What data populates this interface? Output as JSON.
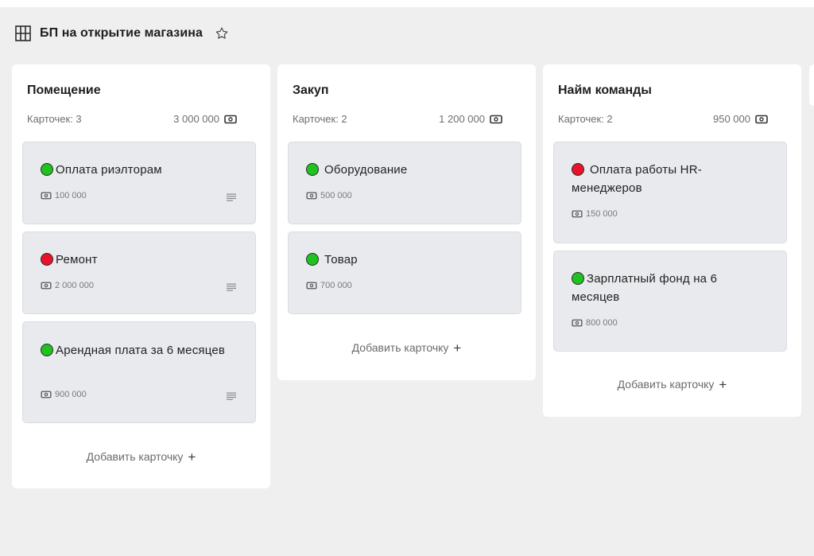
{
  "board": {
    "title": "БП на открытие магазина",
    "icons": {
      "board": "board-grid-icon",
      "favorite": "star-outline-icon"
    }
  },
  "colors": {
    "background": "#efefef",
    "column": "#ffffff",
    "card": "#e9eaed",
    "status_green": "#1fc21f",
    "status_red": "#e8132b"
  },
  "columns": [
    {
      "title": "Помещение",
      "count_label": "Карточек: 3",
      "sum": "3 000 000",
      "add_label": "Добавить карточку",
      "cards": [
        {
          "title": "Оплата риэлторам",
          "status": "green",
          "amount": "100 000",
          "has_description": true
        },
        {
          "title": "Ремонт",
          "status": "red",
          "amount": "2 000 000",
          "has_description": true
        },
        {
          "title": "Арендная плата за 6 месяцев",
          "status": "green",
          "amount": "900 000",
          "has_description": true
        }
      ]
    },
    {
      "title": "Закуп",
      "count_label": "Карточек: 2",
      "sum": "1 200 000",
      "add_label": "Добавить карточку",
      "cards": [
        {
          "title": "Оборудование",
          "status": "green",
          "amount": "500 000",
          "has_description": false
        },
        {
          "title": "Товар",
          "status": "green",
          "amount": "700 000",
          "has_description": false
        }
      ]
    },
    {
      "title": "Найм команды",
      "count_label": "Карточек: 2",
      "sum": "950 000",
      "add_label": "Добавить карточку",
      "cards": [
        {
          "title": "Оплата работы HR-менеджеров",
          "status": "red",
          "amount": "150 000",
          "has_description": false
        },
        {
          "title": "Зарплатный фонд на 6 месяцев",
          "status": "green",
          "amount": "800 000",
          "has_description": false
        }
      ]
    }
  ],
  "add_icon": "plus-icon"
}
